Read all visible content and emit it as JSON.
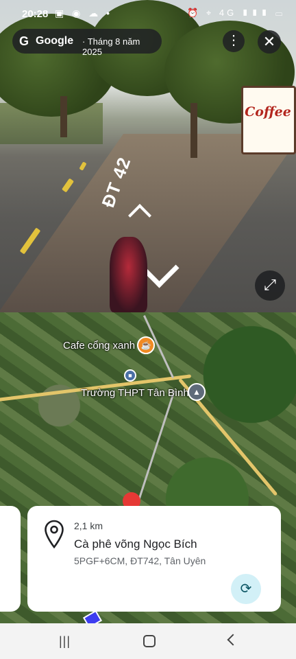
{
  "status_bar": {
    "time": "20:28",
    "notification_icons": "▣ ◉ ☁ •",
    "right_icons": "⏰ ⌖ 4G ▮▮▮ ▭"
  },
  "street_view": {
    "provider": "Google",
    "capture_date": "· Tháng 8 năm 2025",
    "road_label": "ĐT 42",
    "sign_text": "Coffee",
    "menu_icon": "⋮",
    "close_icon": "✕",
    "expand_icon": "⤢"
  },
  "map": {
    "pois": [
      {
        "label": "Cafe cổng xanh"
      },
      {
        "label": "Trường THPT Tân Bình"
      }
    ]
  },
  "place_card": {
    "distance": "2,1 km",
    "name": "Cà phê võng Ngọc Bích",
    "address": "5PGF+6CM, ĐT742, Tân Uyên",
    "rotate_icon": "⟳"
  },
  "nav_bar": {
    "recents": "|||"
  }
}
